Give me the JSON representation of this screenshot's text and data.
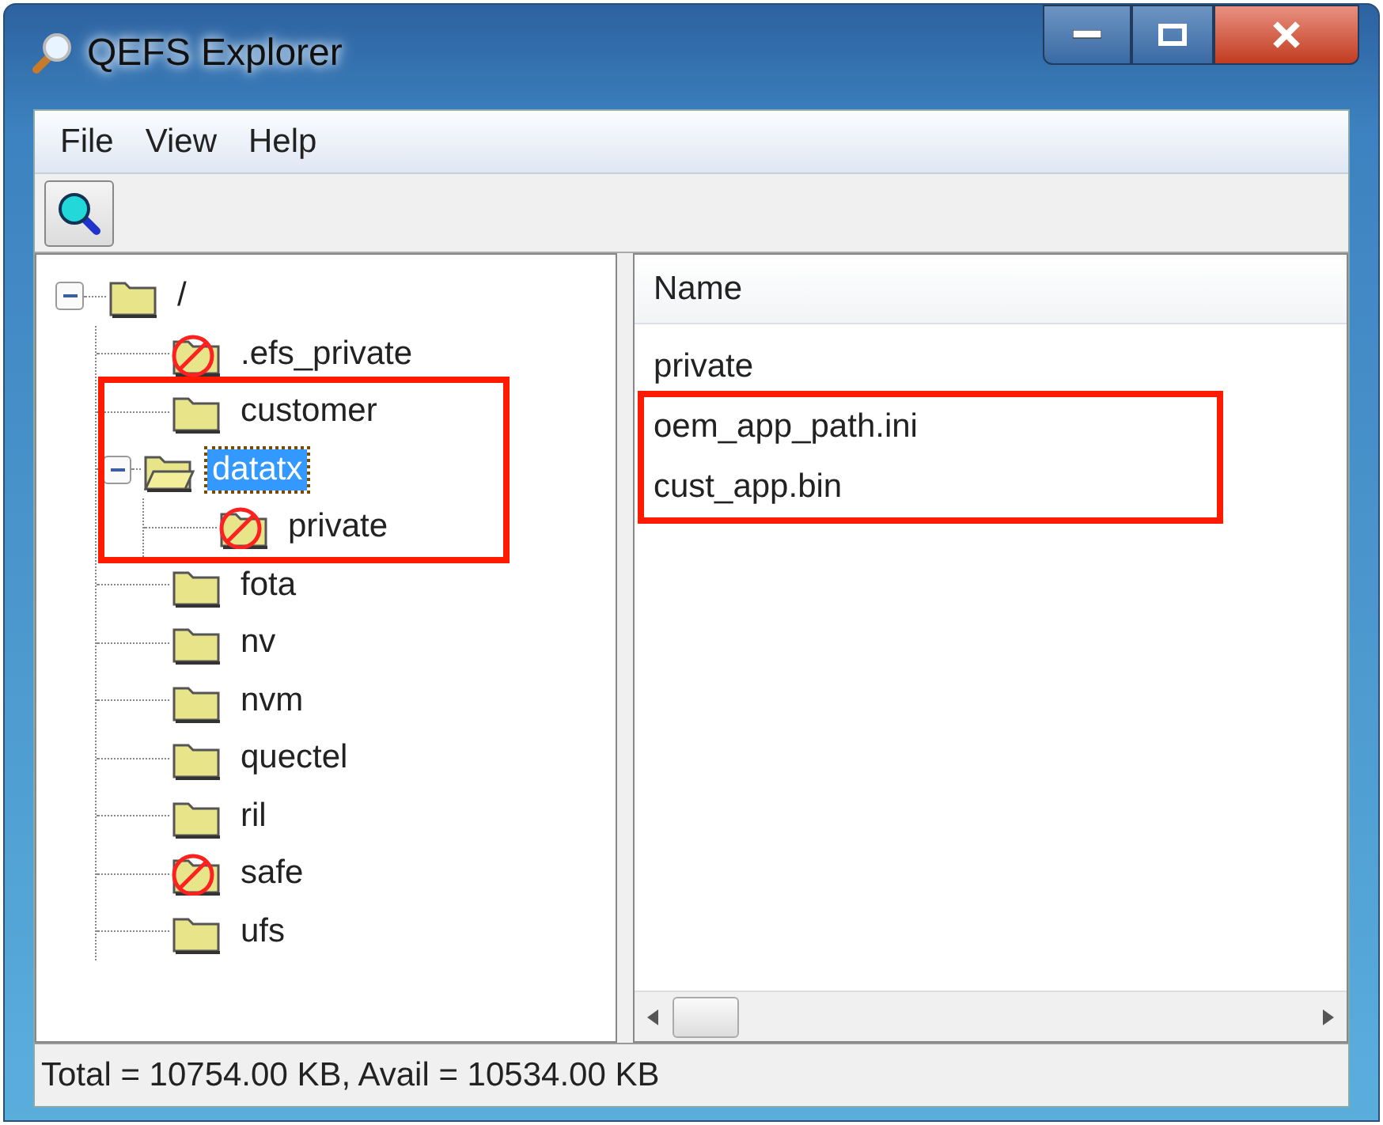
{
  "window": {
    "title": "QEFS Explorer"
  },
  "menu": [
    {
      "label": "File"
    },
    {
      "label": "View"
    },
    {
      "label": "Help"
    }
  ],
  "toolbar": [
    {
      "kind": "search"
    }
  ],
  "tree": [
    {
      "label": "/",
      "expanded": true,
      "selected": false,
      "restricted": false,
      "children": [
        {
          "label": ".efs_private",
          "selected": false,
          "restricted": true
        },
        {
          "label": "customer",
          "selected": false,
          "restricted": false,
          "highlighted": true
        },
        {
          "label": "datatx",
          "expanded": true,
          "selected": true,
          "restricted": false,
          "highlighted": true,
          "children": [
            {
              "label": "private",
              "selected": false,
              "restricted": true,
              "highlighted": true
            }
          ]
        },
        {
          "label": "fota",
          "selected": false,
          "restricted": false
        },
        {
          "label": "nv",
          "selected": false,
          "restricted": false
        },
        {
          "label": "nvm",
          "selected": false,
          "restricted": false
        },
        {
          "label": "quectel",
          "selected": false,
          "restricted": false
        },
        {
          "label": "ril",
          "selected": false,
          "restricted": false
        },
        {
          "label": "safe",
          "selected": false,
          "restricted": true
        },
        {
          "label": "ufs",
          "selected": false,
          "restricted": false
        }
      ]
    }
  ],
  "file_list": {
    "columns": [
      "Name"
    ],
    "rows": [
      {
        "name": "private"
      },
      {
        "name": "oem_app_path.ini",
        "highlighted": true
      },
      {
        "name": "cust_app.bin",
        "highlighted": true
      }
    ]
  },
  "status_bar": "Total = 10754.00 KB, Avail = 10534.00 KB"
}
